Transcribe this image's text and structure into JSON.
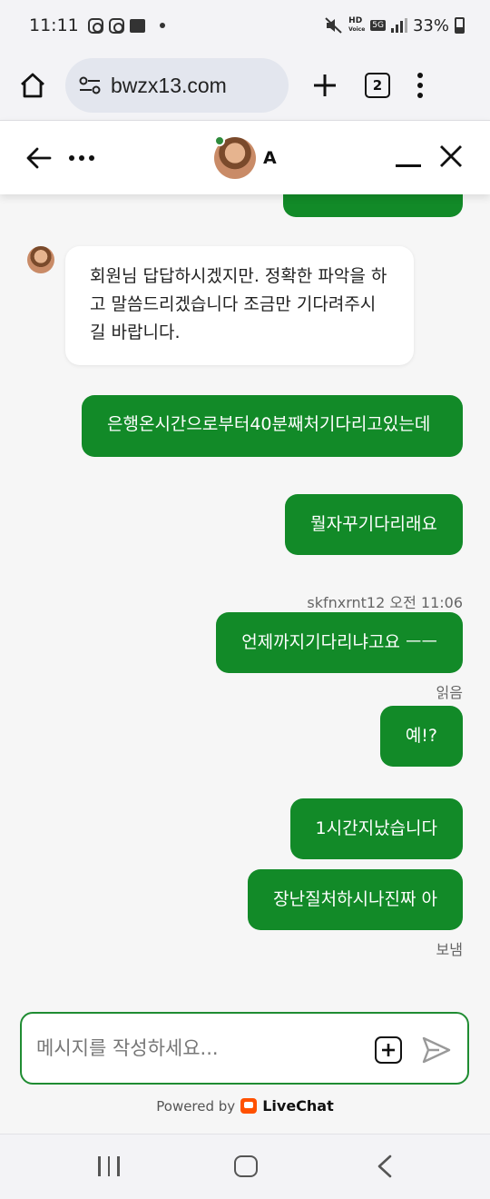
{
  "status_bar": {
    "time": "11:11",
    "network_hd": "HD",
    "network_voice": "Voice",
    "network_type": "5G",
    "battery": "33%"
  },
  "browser": {
    "url": "bwzx13.com",
    "tab_count": "2"
  },
  "chat_header": {
    "agent_name": "A",
    "status_color": "#2e8b3c"
  },
  "messages": {
    "agent_message": "회원님 답답하시겠지만. 정확한 파악을 하고 말씀드리겠습니다 조금만 기다려주시길 바랍니다.",
    "out1": "은행온시간으로부터40분째처기다리고있는데",
    "out2": "뭘자꾸기다리래요",
    "meta_sender": "skfnxrnt12 오전 11:06",
    "out3": "언제까지기다리냐고요 ㅡㅡ",
    "read_status": "읽음",
    "out4": "예!?",
    "out5": "1시간지났습니다",
    "out6": "장난질처하시나진짜 아",
    "sent_status": "보냄"
  },
  "composer": {
    "placeholder": "메시지를 작성하세요...",
    "powered_by": "Powered by",
    "brand": "LiveChat"
  },
  "colors": {
    "bubble_green": "#128a28",
    "composer_border": "#1f8c32",
    "livechat_orange": "#ff5100"
  }
}
